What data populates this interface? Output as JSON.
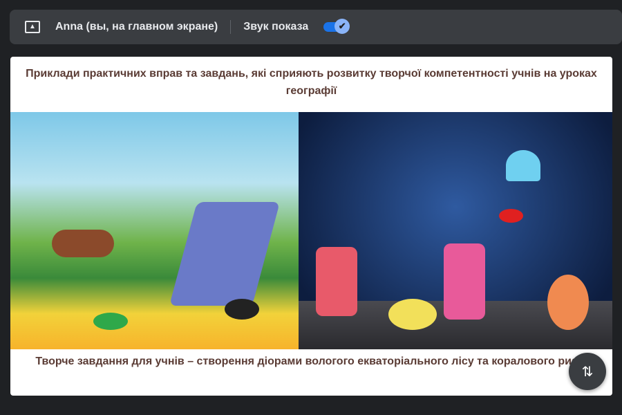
{
  "topbar": {
    "presenter_label": "Anna (вы, на главном экране)",
    "sound_label": "Звук показа",
    "sound_enabled": true
  },
  "slide": {
    "title": "Приклади практичних вправ та завдань, які сприяють розвитку творчої компетентності учнів на уроках географії",
    "caption": "Творче завдання для учнів – створення діорами вологого екваторіального лісу та коралового рифу"
  },
  "colors": {
    "accent": "#1a73e8",
    "title_text": "#5a3b34"
  }
}
